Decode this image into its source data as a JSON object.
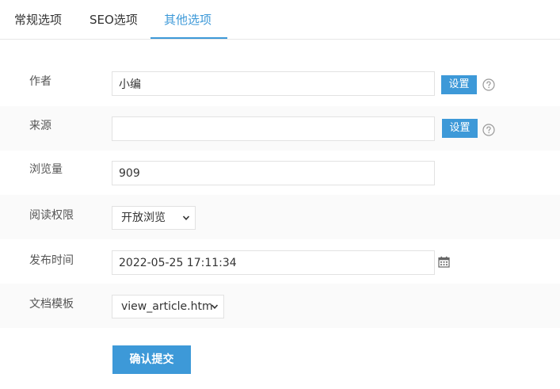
{
  "tabs": [
    {
      "label": "常规选项",
      "active": false
    },
    {
      "label": "SEO选项",
      "active": false
    },
    {
      "label": "其他选项",
      "active": true
    }
  ],
  "form": {
    "author": {
      "label": "作者",
      "value": "小编",
      "button": "设置"
    },
    "source": {
      "label": "来源",
      "value": "",
      "button": "设置"
    },
    "views": {
      "label": "浏览量",
      "value": "909"
    },
    "permission": {
      "label": "阅读权限",
      "selected": "开放浏览"
    },
    "publish_time": {
      "label": "发布时间",
      "value": "2022-05-25 17:11:34"
    },
    "template": {
      "label": "文档模板",
      "selected": "view_article.htm"
    }
  },
  "submit_label": "确认提交",
  "colors": {
    "accent": "#3d99d8",
    "row_alt": "#fafafa",
    "border": "#e2e2e2"
  },
  "icons": {
    "help": "question-circle-icon",
    "calendar": "calendar-icon",
    "dropdown": "chevron-down-icon"
  }
}
